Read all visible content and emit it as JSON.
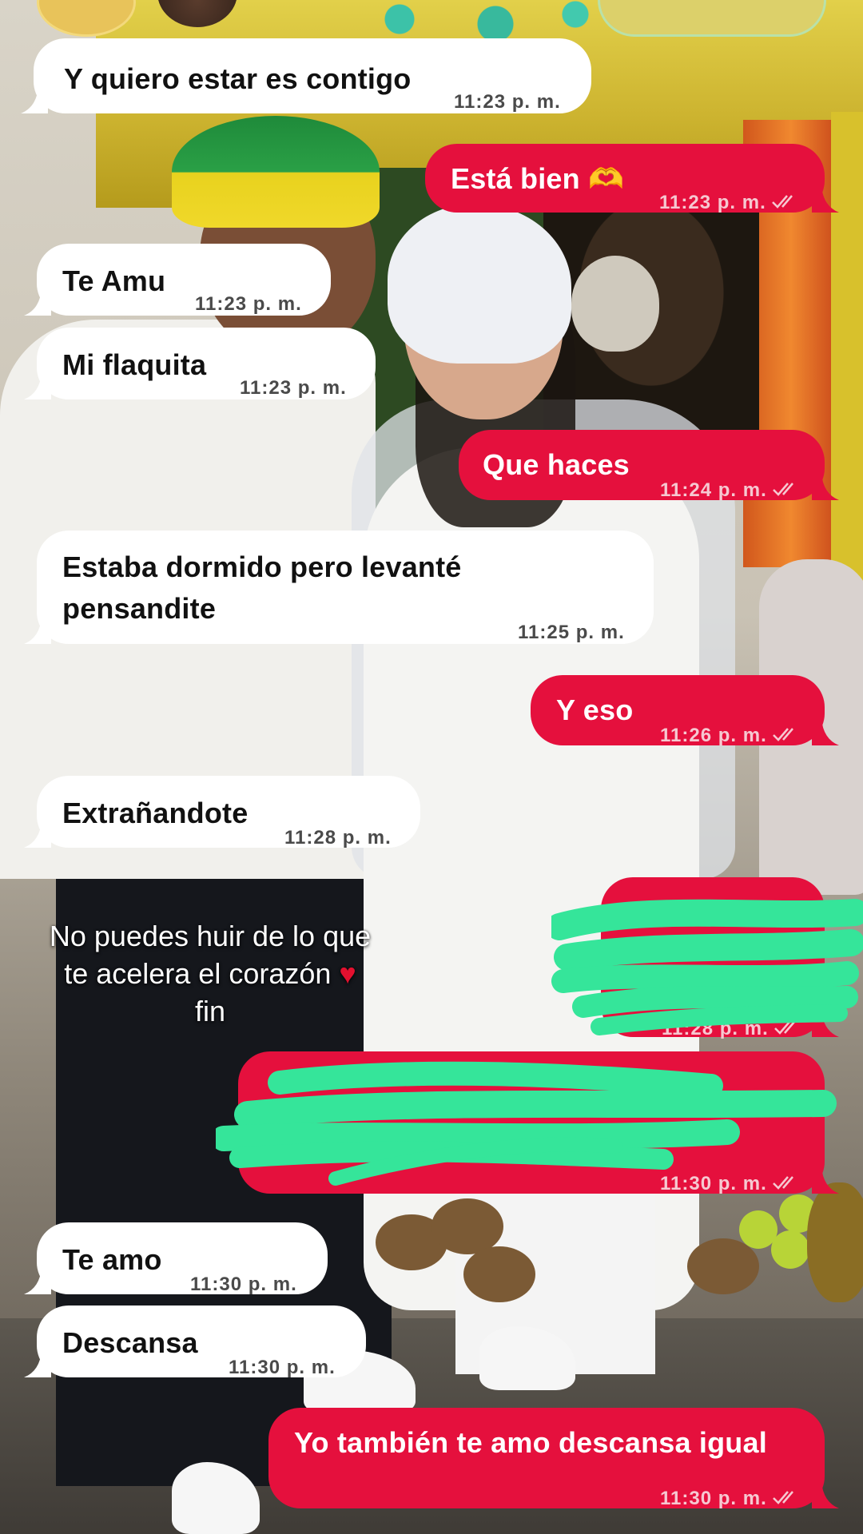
{
  "messages": [
    {
      "dir": "in",
      "text": "Y quiero estar es contigo",
      "time": "11:23 p. m."
    },
    {
      "dir": "out",
      "text": "Está bien 🫶",
      "time": "11:23 p. m."
    },
    {
      "dir": "in",
      "text": "Te Amu",
      "time": "11:23 p. m."
    },
    {
      "dir": "in",
      "text": "Mi flaquita",
      "time": "11:23 p. m."
    },
    {
      "dir": "out",
      "text": "Que haces",
      "time": "11:24 p. m."
    },
    {
      "dir": "in",
      "text_line1": "Estaba dormido pero levanté",
      "text_line2": "pensandite",
      "time": "11:25 p. m."
    },
    {
      "dir": "out",
      "text": "Y eso",
      "time": "11:26 p. m."
    },
    {
      "dir": "in",
      "text": "Extrañandote",
      "time": "11:28 p. m."
    },
    {
      "dir": "out",
      "text": "",
      "time": "11:28 p. m.",
      "censored": true
    },
    {
      "dir": "out",
      "text": "",
      "time": "11:30 p. m.",
      "censored": true
    },
    {
      "dir": "in",
      "text": "Te amo",
      "time": "11:30 p. m."
    },
    {
      "dir": "in",
      "text": "Descansa",
      "time": "11:30 p. m."
    },
    {
      "dir": "out",
      "text": "Yo también te amo descansa igual",
      "time": "11:30 p. m."
    }
  ],
  "caption": {
    "line1": "No puedes huir de lo que",
    "line2": "te acelera el corazón",
    "heart": "♥",
    "line3": "fin"
  },
  "colors": {
    "incoming_bubble": "#ffffff",
    "outgoing_bubble": "#e5103d",
    "scribble": "#35e59a"
  },
  "icons": {
    "read_receipt": "double-check-icon",
    "emoji": "heart-hands-emoji"
  }
}
